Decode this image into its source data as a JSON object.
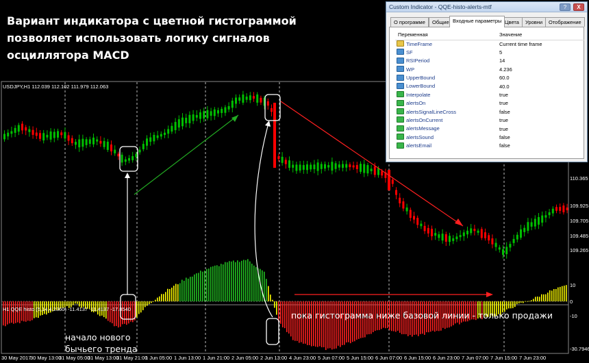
{
  "headline": [
    "Вариант индикатора с цветной гистограммой",
    "позволяет использовать логику сигналов",
    "осциллятора MACD"
  ],
  "annotations": {
    "sell_note": "пока гистограмма ниже базовой линии - только продажи",
    "trend_start_line1": "начало нового",
    "trend_start_line2": "бычьего тренда"
  },
  "chart": {
    "symbol_info": "USDJPY,H1  112.039 112.102 111.979 112.063",
    "indicator_info": "H1 QQE histo (5,14,4.2360) -11.4137 -11.4137 -17.8540",
    "price_labels": [
      "110.365",
      "109.925",
      "109.705",
      "109.485",
      "109.265"
    ],
    "osc_labels": [
      "10",
      "0",
      "-10",
      "-30.7946"
    ],
    "time_labels": [
      "30 May 2017",
      "30 May 13:00",
      "31 May 05:00",
      "31 May 13:00",
      "31 May 21:00",
      "1 Jun 05:00",
      "1 Jun 13:00",
      "1 Jun 21:00",
      "2 Jun 05:00",
      "2 Jun 13:00",
      "4 Jun 23:00",
      "5 Jun 07:00",
      "5 Jun 15:00",
      "6 Jun 07:00",
      "6 Jun 15:00",
      "6 Jun 23:00",
      "7 Jun 07:00",
      "7 Jun 15:00",
      "7 Jun 23:00"
    ],
    "colors": {
      "bull_candle": "#00c000",
      "bear_candle": "#ff0000",
      "hist_green": "#22c022",
      "hist_yellow": "#ffff00",
      "hist_red": "#ff2020",
      "arrow_green": "#22aa22",
      "arrow_red": "#ff2020"
    }
  },
  "dialog": {
    "title": "Custom Indicator - QQE-histo-alerts-mtf",
    "help_label": "?",
    "close_label": "X",
    "tabs": [
      "О программе",
      "Общие",
      "Входные параметры",
      "Цвета",
      "Уровни",
      "Отображение"
    ],
    "active_tab": "Входные параметры",
    "col_variable": "Переменная",
    "col_value": "Значение",
    "params": [
      {
        "icon": "enum",
        "name": "TimeFrame",
        "value": "Current time frame"
      },
      {
        "icon": "num",
        "name": "SF",
        "value": "5"
      },
      {
        "icon": "num",
        "name": "RSIPeriod",
        "value": "14"
      },
      {
        "icon": "num",
        "name": "WP",
        "value": "4.236"
      },
      {
        "icon": "num",
        "name": "UpperBound",
        "value": "60.0"
      },
      {
        "icon": "num",
        "name": "LowerBound",
        "value": "40.0"
      },
      {
        "icon": "bool",
        "name": "Interpolate",
        "value": "true"
      },
      {
        "icon": "bool",
        "name": "alertsOn",
        "value": "true"
      },
      {
        "icon": "bool",
        "name": "alertsSignalLineCross",
        "value": "false"
      },
      {
        "icon": "bool",
        "name": "alertsOnCurrent",
        "value": "true"
      },
      {
        "icon": "bool",
        "name": "alertsMessage",
        "value": "true"
      },
      {
        "icon": "bool",
        "name": "alertsSound",
        "value": "false"
      },
      {
        "icon": "bool",
        "name": "alertsEmail",
        "value": "false"
      }
    ]
  }
}
